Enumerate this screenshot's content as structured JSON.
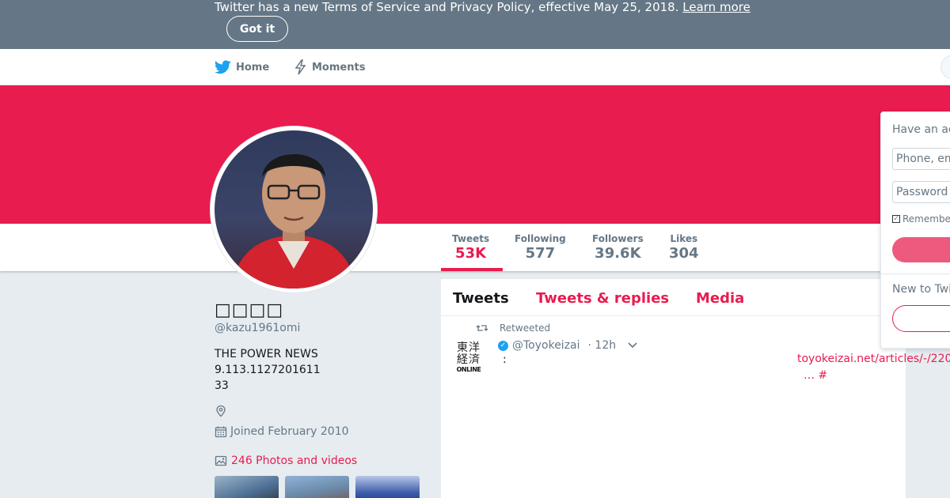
{
  "banner": {
    "text": "Twitter has a new Terms of Service and Privacy Policy, effective May 25, 2018.",
    "link": "Learn more",
    "button": "Got it"
  },
  "nav": {
    "home": "Home",
    "moments": "Moments"
  },
  "colors": {
    "accent": "#e81c4f",
    "banner_bg": "#657786",
    "page_bg": "#e6ecf0"
  },
  "profile": {
    "name": "□□□□",
    "handle": "@kazu1961omi",
    "bio": "THE POWER NEWS\n9.113.1127201611\n33",
    "joined": "Joined February 2010",
    "photos": "246 Photos and videos"
  },
  "stats": [
    {
      "label": "Tweets",
      "value": "53K"
    },
    {
      "label": "Following",
      "value": "577"
    },
    {
      "label": "Followers",
      "value": "39.6K"
    },
    {
      "label": "Likes",
      "value": "304"
    }
  ],
  "timeline": {
    "tabs": [
      "Tweets",
      "Tweets & replies",
      "Media"
    ],
    "tweet": {
      "retweeted": "Retweeted",
      "avatar_text": "東洋\n経済",
      "avatar_sub": "ONLINE",
      "handle": "@Toyokeizai",
      "time": "· 12h",
      "text": ":",
      "link": "toyokeizai.net/articles/-/220",
      "link2": "… #"
    }
  },
  "login": {
    "title": "Have an account?",
    "phone_placeholder": "Phone, email or username",
    "password_placeholder": "Password",
    "remember": "Remember me"
  },
  "signup": {
    "prompt": "New to Twitter?"
  }
}
